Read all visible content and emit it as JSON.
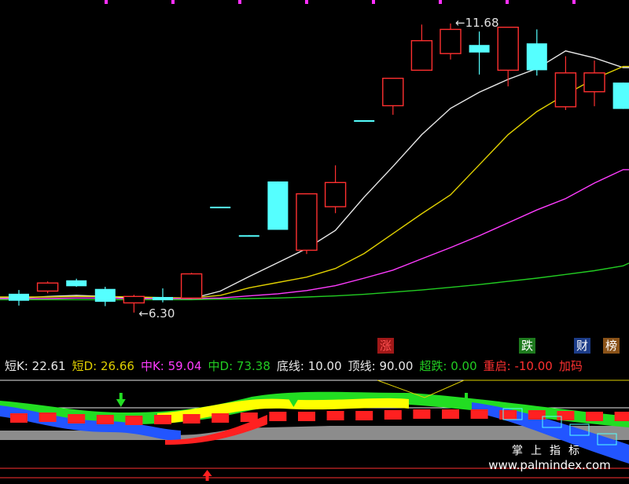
{
  "colors": {
    "up": "#ff3030",
    "down": "#55ffff",
    "ma1": "#e8e8e8",
    "ma2": "#e0d000",
    "ma3": "#ff3cff",
    "ma4": "#22cc22",
    "tick": "#ff30ff",
    "panel_grey": "#8c8c8c",
    "panel_bar": "#ff2020"
  },
  "chart_data": [
    {
      "type": "candlestick",
      "title": "",
      "xlabel": "",
      "ylabel": "",
      "ylim": [
        5.8,
        12.0
      ],
      "grid": false,
      "annotations": [
        {
          "text": "←6.30",
          "value": 6.3,
          "bar_index": 4
        },
        {
          "text": "←11.68",
          "value": 11.68,
          "bar_index": 15
        }
      ],
      "candles": [
        {
          "o": 6.65,
          "c": 6.52,
          "h": 6.72,
          "l": 6.43
        },
        {
          "o": 6.7,
          "c": 6.85,
          "h": 6.88,
          "l": 6.66
        },
        {
          "o": 6.9,
          "c": 6.79,
          "h": 6.93,
          "l": 6.78
        },
        {
          "o": 6.74,
          "c": 6.5,
          "h": 6.78,
          "l": 6.42
        },
        {
          "o": 6.48,
          "c": 6.6,
          "h": 6.63,
          "l": 6.3
        },
        {
          "o": 6.59,
          "c": 6.53,
          "h": 6.75,
          "l": 6.49
        },
        {
          "o": 6.57,
          "c": 7.02,
          "h": 7.04,
          "l": 6.56
        },
        {
          "o": 8.27,
          "c": 8.26,
          "h": 8.27,
          "l": 8.26
        },
        {
          "o": 7.74,
          "c": 7.73,
          "h": 7.74,
          "l": 7.73
        },
        {
          "o": 8.74,
          "c": 7.84,
          "h": 8.74,
          "l": 7.84
        },
        {
          "o": 7.46,
          "c": 8.51,
          "h": 8.52,
          "l": 7.39
        },
        {
          "o": 8.27,
          "c": 8.72,
          "h": 9.04,
          "l": 8.15
        },
        {
          "o": 9.88,
          "c": 9.87,
          "h": 9.88,
          "l": 9.87
        },
        {
          "o": 10.15,
          "c": 10.66,
          "h": 10.66,
          "l": 9.98
        },
        {
          "o": 10.81,
          "c": 11.36,
          "h": 11.66,
          "l": 10.81
        },
        {
          "o": 11.12,
          "c": 11.57,
          "h": 11.68,
          "l": 11.01
        },
        {
          "o": 11.28,
          "c": 11.14,
          "h": 11.53,
          "l": 10.73
        },
        {
          "o": 10.81,
          "c": 11.61,
          "h": 11.61,
          "l": 10.51
        },
        {
          "o": 11.31,
          "c": 10.81,
          "h": 11.57,
          "l": 10.71
        },
        {
          "o": 10.13,
          "c": 10.76,
          "h": 11.07,
          "l": 10.07
        },
        {
          "o": 10.41,
          "c": 10.76,
          "h": 10.99,
          "l": 10.14
        },
        {
          "o": 10.58,
          "c": 10.09,
          "h": 10.58,
          "l": 10.09
        }
      ],
      "series": [
        {
          "name": "",
          "values": [
            6.57,
            6.6,
            6.62,
            6.6,
            6.57,
            6.57,
            6.56,
            6.7,
            6.97,
            7.23,
            7.49,
            7.83,
            8.45,
            9.02,
            9.61,
            10.1,
            10.4,
            10.64,
            10.84,
            11.17,
            11.04,
            10.86
          ]
        },
        {
          "name": "",
          "values": [
            6.59,
            6.59,
            6.6,
            6.6,
            6.59,
            6.58,
            6.57,
            6.62,
            6.76,
            6.86,
            6.96,
            7.12,
            7.4,
            7.77,
            8.14,
            8.49,
            9.05,
            9.61,
            10.04,
            10.36,
            10.65,
            10.88
          ]
        },
        {
          "name": "",
          "values": [
            6.56,
            6.56,
            6.57,
            6.57,
            6.56,
            6.56,
            6.56,
            6.57,
            6.61,
            6.65,
            6.71,
            6.8,
            6.94,
            7.09,
            7.3,
            7.51,
            7.73,
            7.97,
            8.21,
            8.42,
            8.71,
            8.96
          ]
        },
        {
          "name": "",
          "values": [
            6.54,
            6.54,
            6.54,
            6.54,
            6.54,
            6.54,
            6.54,
            6.55,
            6.56,
            6.57,
            6.59,
            6.61,
            6.64,
            6.68,
            6.72,
            6.77,
            6.82,
            6.88,
            6.94,
            7.01,
            7.08,
            7.17
          ]
        }
      ]
    },
    {
      "type": "band",
      "ylim": [
        0,
        100
      ],
      "indicators": [
        {
          "label": "短K: 22.61",
          "color": "#e8e8e8"
        },
        {
          "label": "短D: 26.66",
          "color": "#e0d000"
        },
        {
          "label": "中K: 59.04",
          "color": "#ff3cff"
        },
        {
          "label": "中D: 73.38",
          "color": "#22cc22"
        },
        {
          "label": "底线: 10.00",
          "color": "#e8e8e8"
        },
        {
          "label": "顶线: 90.00",
          "color": "#e8e8e8"
        },
        {
          "label": "超跌: 0.00",
          "color": "#22cc22"
        },
        {
          "label": "重启: -10.00",
          "color": "#ff3030"
        },
        {
          "label": "加码",
          "color": "#ff3030"
        }
      ],
      "tags": [
        {
          "text": "涨",
          "bg": "#a01818",
          "color": "#ff5050"
        },
        {
          "text": "跌",
          "bg": "#1e7a1e",
          "color": "#ffffff"
        },
        {
          "text": "财",
          "bg": "#1c3c88",
          "color": "#ffffff"
        },
        {
          "text": "榜",
          "bg": "#8a5218",
          "color": "#ffffff"
        }
      ],
      "signals_down": [
        3,
        9,
        15
      ],
      "signals_up": [
        6
      ],
      "bars": [
        6,
        7,
        5,
        4,
        3,
        4,
        5,
        6,
        7,
        8,
        8,
        9,
        9,
        10,
        11,
        11,
        11,
        10,
        10,
        9,
        8,
        8
      ]
    }
  ],
  "watermark": {
    "line1": "掌上指标",
    "line2": "www.palmindex.com"
  }
}
